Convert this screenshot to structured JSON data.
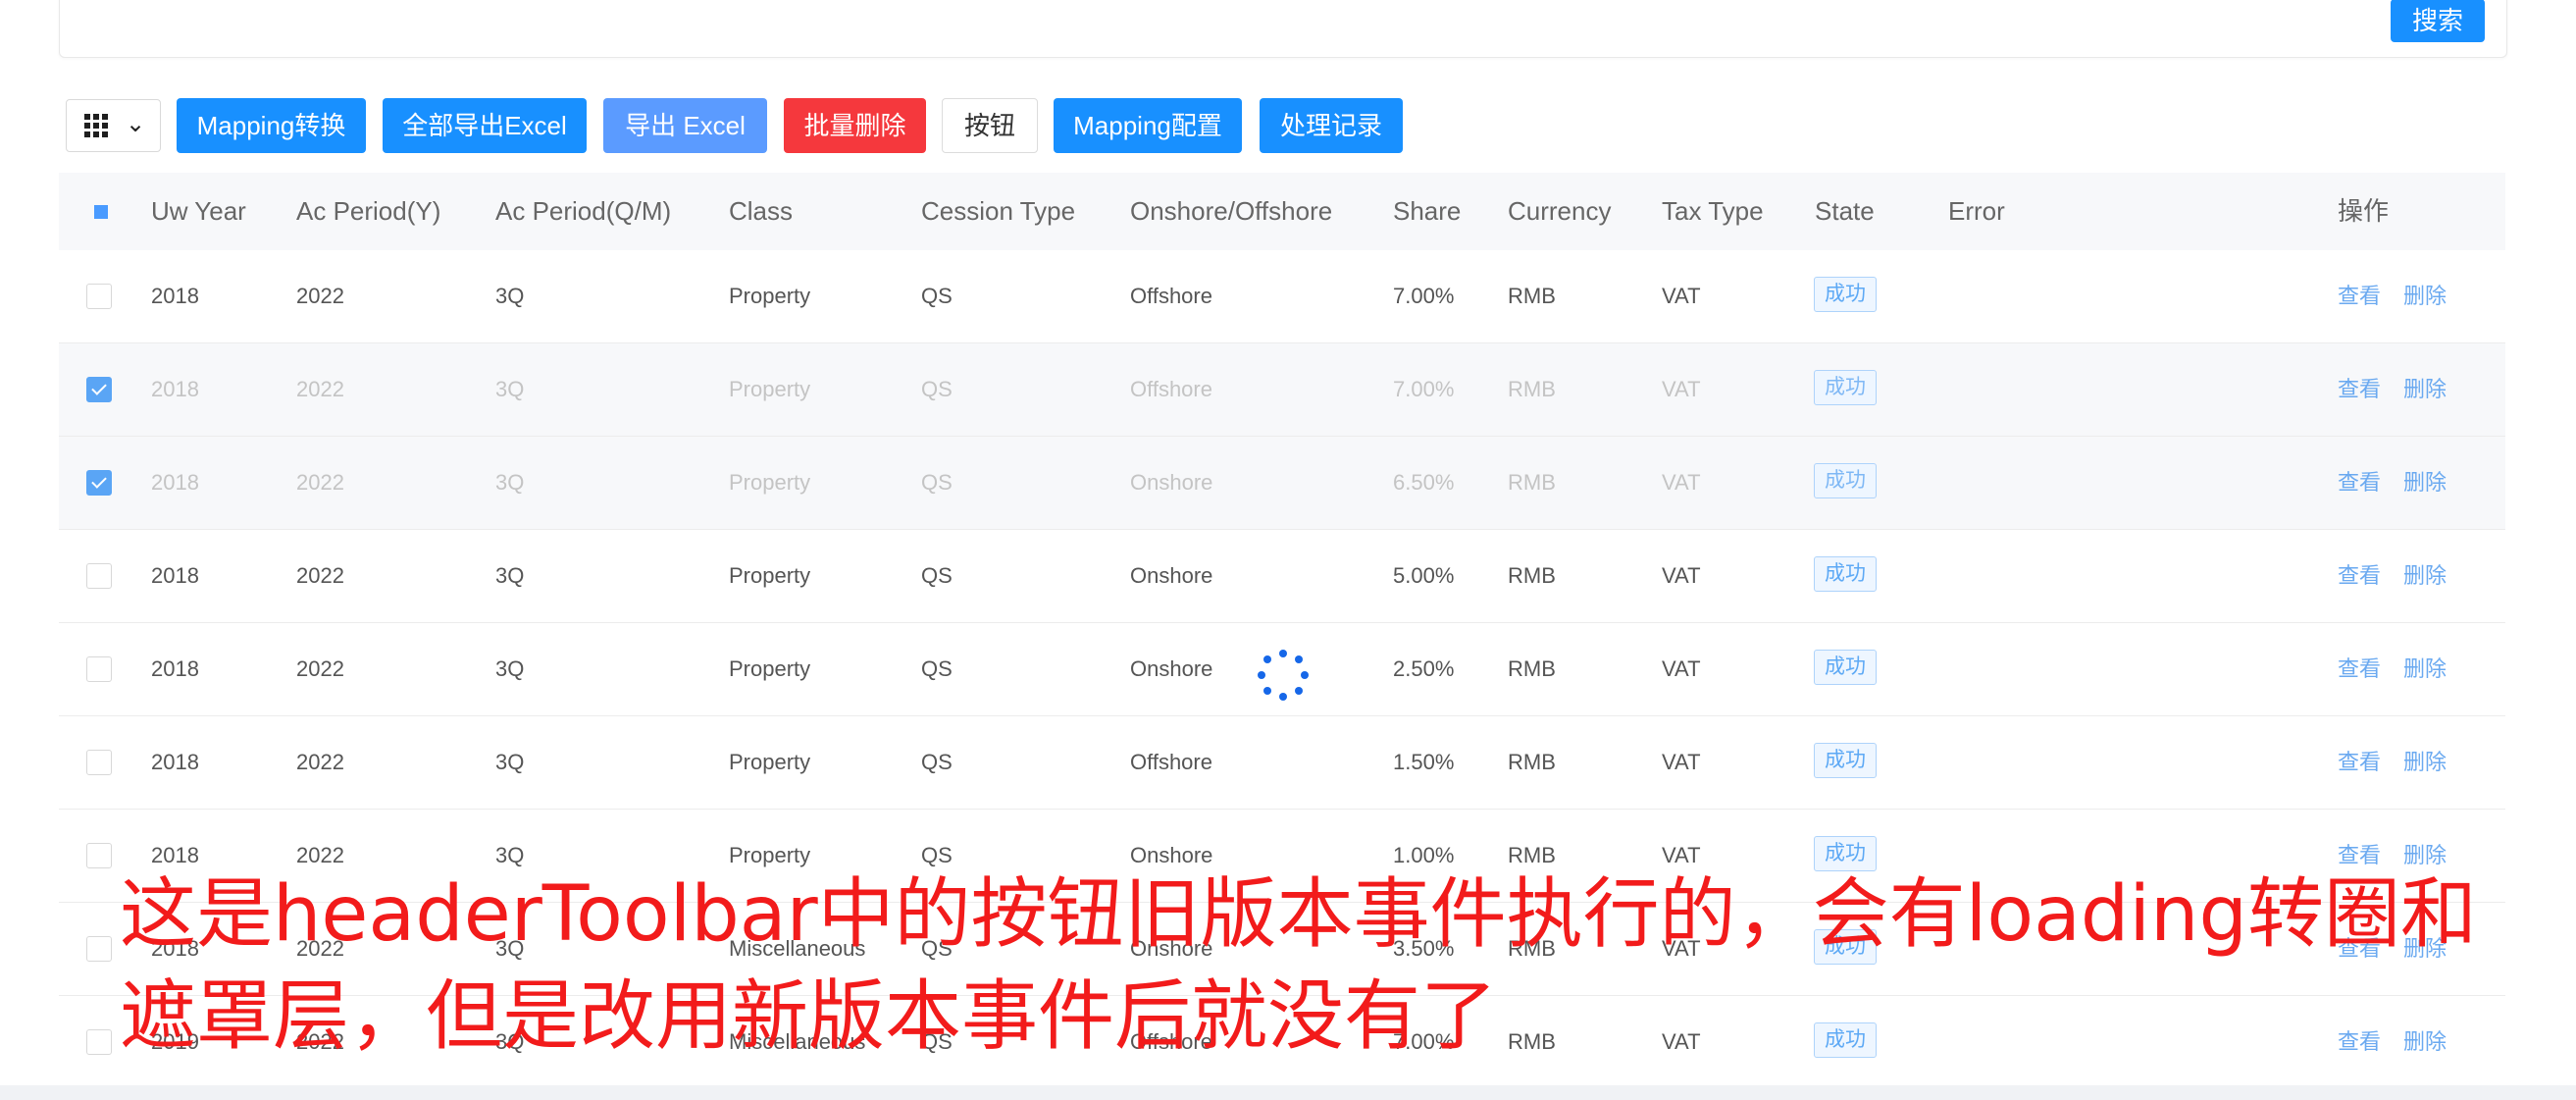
{
  "search": {
    "button_label": "搜索"
  },
  "toolbar": {
    "buttons": [
      {
        "label": "Mapping转换"
      },
      {
        "label": "全部导出Excel"
      },
      {
        "label": "导出 Excel"
      },
      {
        "label": "批量删除"
      },
      {
        "label": "按钮"
      },
      {
        "label": "Mapping配置"
      },
      {
        "label": "处理记录"
      }
    ]
  },
  "table": {
    "columns": [
      "Uw Year",
      "Ac Period(Y)",
      "Ac Period(Q/M)",
      "Class",
      "Cession Type",
      "Onshore/Offshore",
      "Share",
      "Currency",
      "Tax Type",
      "State",
      "Error",
      "操作"
    ],
    "rows": [
      {
        "uw_year": "2018",
        "ac_period_y": "2022",
        "ac_period_qm": "3Q",
        "class": "Property",
        "cession_type": "QS",
        "onshore_offshore": "Offshore",
        "share": "7.00%",
        "currency": "RMB",
        "tax_type": "VAT",
        "state": "成功",
        "error": "",
        "view": "查看",
        "delete": "删除",
        "selected": false
      },
      {
        "uw_year": "2018",
        "ac_period_y": "2022",
        "ac_period_qm": "3Q",
        "class": "Property",
        "cession_type": "QS",
        "onshore_offshore": "Offshore",
        "share": "7.00%",
        "currency": "RMB",
        "tax_type": "VAT",
        "state": "成功",
        "error": "",
        "view": "查看",
        "delete": "删除",
        "selected": true
      },
      {
        "uw_year": "2018",
        "ac_period_y": "2022",
        "ac_period_qm": "3Q",
        "class": "Property",
        "cession_type": "QS",
        "onshore_offshore": "Onshore",
        "share": "6.50%",
        "currency": "RMB",
        "tax_type": "VAT",
        "state": "成功",
        "error": "",
        "view": "查看",
        "delete": "删除",
        "selected": true
      },
      {
        "uw_year": "2018",
        "ac_period_y": "2022",
        "ac_period_qm": "3Q",
        "class": "Property",
        "cession_type": "QS",
        "onshore_offshore": "Onshore",
        "share": "5.00%",
        "currency": "RMB",
        "tax_type": "VAT",
        "state": "成功",
        "error": "",
        "view": "查看",
        "delete": "删除",
        "selected": false
      },
      {
        "uw_year": "2018",
        "ac_period_y": "2022",
        "ac_period_qm": "3Q",
        "class": "Property",
        "cession_type": "QS",
        "onshore_offshore": "Onshore",
        "share": "2.50%",
        "currency": "RMB",
        "tax_type": "VAT",
        "state": "成功",
        "error": "",
        "view": "查看",
        "delete": "删除",
        "selected": false
      },
      {
        "uw_year": "2018",
        "ac_period_y": "2022",
        "ac_period_qm": "3Q",
        "class": "Property",
        "cession_type": "QS",
        "onshore_offshore": "Offshore",
        "share": "1.50%",
        "currency": "RMB",
        "tax_type": "VAT",
        "state": "成功",
        "error": "",
        "view": "查看",
        "delete": "删除",
        "selected": false
      },
      {
        "uw_year": "2018",
        "ac_period_y": "2022",
        "ac_period_qm": "3Q",
        "class": "Property",
        "cession_type": "QS",
        "onshore_offshore": "Onshore",
        "share": "1.00%",
        "currency": "RMB",
        "tax_type": "VAT",
        "state": "成功",
        "error": "",
        "view": "查看",
        "delete": "删除",
        "selected": false
      },
      {
        "uw_year": "2018",
        "ac_period_y": "2022",
        "ac_period_qm": "3Q",
        "class": "Miscellaneous",
        "cession_type": "QS",
        "onshore_offshore": "Onshore",
        "share": "3.50%",
        "currency": "RMB",
        "tax_type": "VAT",
        "state": "成功",
        "error": "",
        "view": "查看",
        "delete": "删除",
        "selected": false
      },
      {
        "uw_year": "2019",
        "ac_period_y": "2022",
        "ac_period_qm": "3Q",
        "class": "Miscellaneous",
        "cession_type": "QS",
        "onshore_offshore": "Offshore",
        "share": "7.00%",
        "currency": "RMB",
        "tax_type": "VAT",
        "state": "成功",
        "error": "",
        "view": "查看",
        "delete": "删除",
        "selected": false
      }
    ]
  },
  "annotation": {
    "text": "这是headerToolbar中的按钮旧版本事件执行的，会有loading转圈和遮罩层，但是改用新版本事件后就没有了"
  },
  "colors": {
    "primary": "#1890ff",
    "danger": "#f5383d",
    "annotation": "#f21b1b",
    "success_tag": "#5da9f5"
  },
  "icons": [
    "grid-icon",
    "chevron-down-icon",
    "loading-spinner-icon"
  ]
}
